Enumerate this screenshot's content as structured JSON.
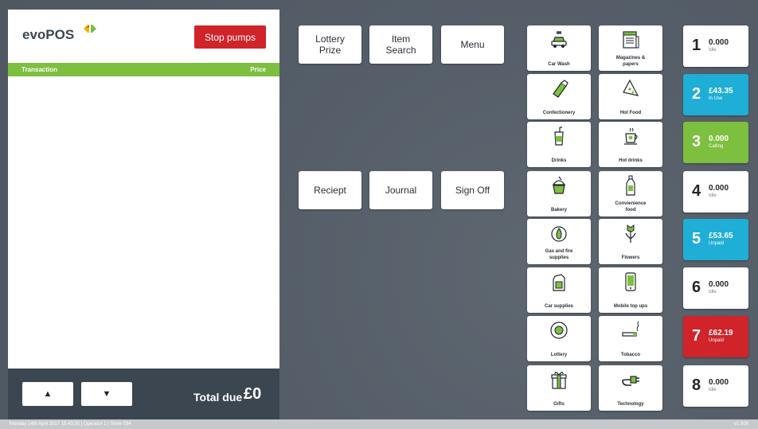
{
  "app": {
    "logo_text": "evoPOS",
    "stop_pumps_label": "Stop pumps"
  },
  "transaction": {
    "column_item": "Transaction",
    "column_price": "Price",
    "total_label": "Total due",
    "total_value": "£0",
    "scroll_up_icon": "▲",
    "scroll_down_icon": "▼"
  },
  "commands": {
    "lottery_prize": "Lottery\nPrize",
    "item_search": "Item\nSearch",
    "menu": "Menu",
    "receipt": "Reciept",
    "journal": "Journal",
    "sign_off": "Sign Off"
  },
  "categories": [
    {
      "label": "Car Wash",
      "icon": "car-wash-icon"
    },
    {
      "label": "Magazines &\npapers",
      "icon": "magazine-icon"
    },
    {
      "label": "Confectionery",
      "icon": "candy-icon"
    },
    {
      "label": "Hot Food",
      "icon": "pizza-icon"
    },
    {
      "label": "Drinks",
      "icon": "cup-icon"
    },
    {
      "label": "Hot drinks",
      "icon": "coffee-icon"
    },
    {
      "label": "Bakery",
      "icon": "cupcake-icon"
    },
    {
      "label": "Convienience\nfood",
      "icon": "bottle-icon"
    },
    {
      "label": "Gas and fire\nsupplies",
      "icon": "flame-icon"
    },
    {
      "label": "Flowers",
      "icon": "flower-icon"
    },
    {
      "label": "Car supplies",
      "icon": "oil-can-icon"
    },
    {
      "label": "Mobile top ups",
      "icon": "phone-icon"
    },
    {
      "label": "Lottery",
      "icon": "lottery-ball-icon"
    },
    {
      "label": "Tobacco",
      "icon": "cigarette-icon"
    },
    {
      "label": "Gifts",
      "icon": "gift-icon"
    },
    {
      "label": "Technology",
      "icon": "plug-icon"
    }
  ],
  "pumps": [
    {
      "number": "1",
      "amount": "0.000",
      "status": "Idle"
    },
    {
      "number": "2",
      "amount": "£43.35",
      "status": "In Use"
    },
    {
      "number": "3",
      "amount": "0.000",
      "status": "Calling"
    },
    {
      "number": "4",
      "amount": "0.000",
      "status": "Idle"
    },
    {
      "number": "5",
      "amount": "£53.65",
      "status": "Unpaid"
    },
    {
      "number": "6",
      "amount": "0.000",
      "status": "Idle"
    },
    {
      "number": "7",
      "amount": "£62.19",
      "status": "Unpaid"
    },
    {
      "number": "8",
      "amount": "0.000",
      "status": "Idle"
    }
  ],
  "status_bar": {
    "left": "Monday 24th April 2017 15:43:35  |  Operator 1  |  Store 034",
    "right": "v1.009"
  },
  "colors": {
    "accent_green": "#7dbf3f",
    "accent_blue": "#1faed6",
    "alert_red": "#d0232a",
    "panel_dark": "#3b4650"
  }
}
